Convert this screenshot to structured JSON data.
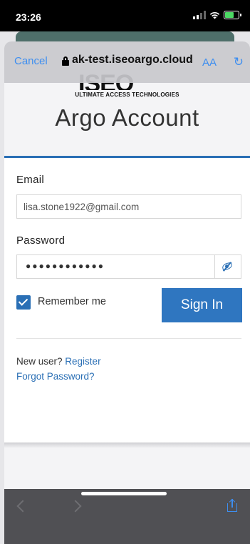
{
  "status_bar": {
    "time": "23:26"
  },
  "browser": {
    "cancel_label": "Cancel",
    "url": "ak-test.iseoargo.cloud",
    "text_size_label": "AA",
    "reload_icon": "reload-icon"
  },
  "header": {
    "logo": "ISEO",
    "tagline": "ULTIMATE ACCESS TECHNOLOGIES",
    "title": "Argo Account"
  },
  "form": {
    "email_label": "Email",
    "email_value": "lisa.stone1922@gmail.com",
    "password_label": "Password",
    "password_value": "●●●●●●●●●●●●",
    "remember_label": "Remember me",
    "remember_checked": true,
    "signin_label": "Sign In"
  },
  "links": {
    "new_user_text": "New user?",
    "register_label": "Register",
    "forgot_label": "Forgot Password?"
  },
  "colors": {
    "accent": "#2f76c0",
    "link": "#3d8ef0"
  }
}
